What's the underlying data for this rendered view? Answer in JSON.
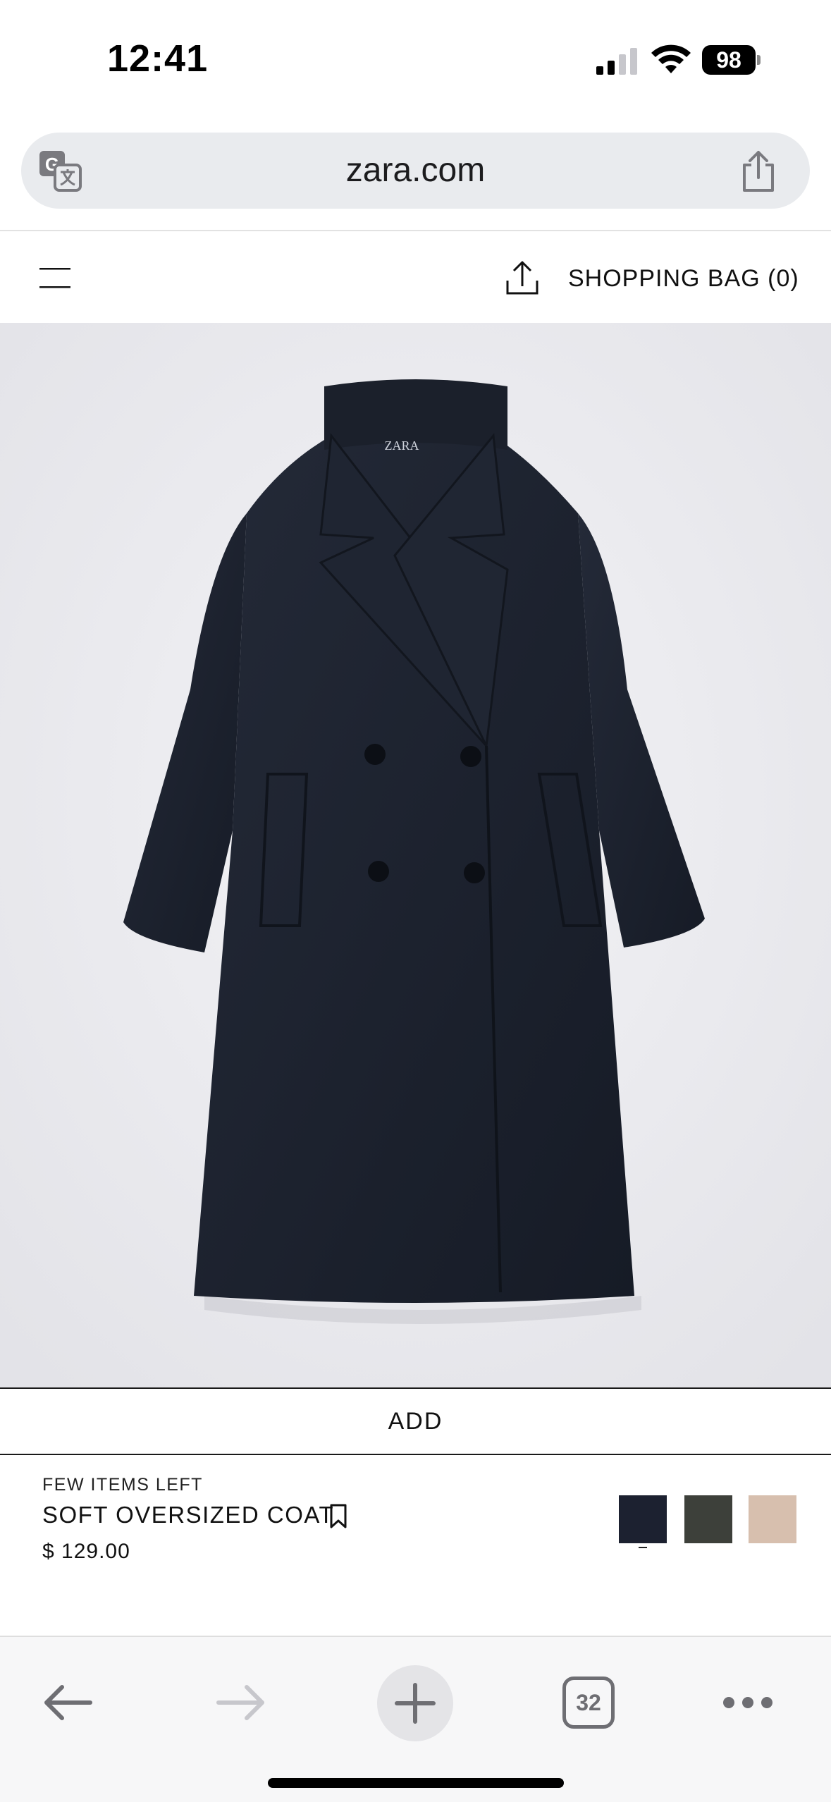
{
  "status_bar": {
    "time": "12:41",
    "battery_level": "98",
    "signal_bars_active": 2
  },
  "browser": {
    "url": "zara.com",
    "tab_count": "32"
  },
  "header": {
    "bag_label": "SHOPPING BAG (0)"
  },
  "product": {
    "image_label": "ZARA",
    "add_label": "ADD",
    "stock_label": "FEW ITEMS LEFT",
    "name": "SOFT OVERSIZED COAT",
    "price": "$ 129.00",
    "colors": [
      "#1c2130",
      "#3d403a",
      "#d7bfae"
    ],
    "selected_color_index": 0
  },
  "icons": {
    "translate": "translate-icon",
    "share": "share-icon",
    "menu": "menu-icon",
    "bookmark": "bookmark-icon",
    "accessibility": "accessibility-icon",
    "back": "back-arrow-icon",
    "forward": "forward-arrow-icon",
    "new_tab": "plus-icon",
    "more": "ellipsis-icon"
  }
}
